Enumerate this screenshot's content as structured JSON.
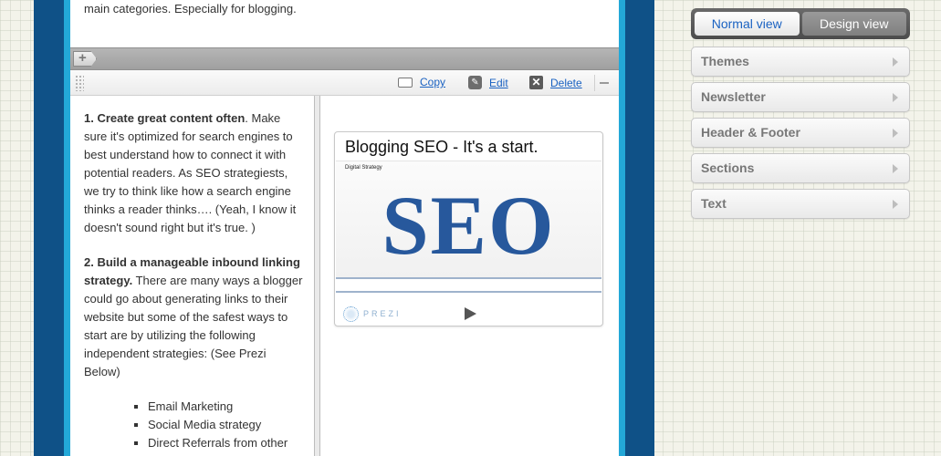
{
  "intro": {
    "text": "main categories. Especially for blogging."
  },
  "add_bar": {
    "add_glyph": "+"
  },
  "toolbar": {
    "copy_label": "Copy",
    "edit_label": "Edit",
    "delete_label": "Delete"
  },
  "content": {
    "para1_bold": "1. Create great content often",
    "para1_rest": ". Make sure it's optimized for search engines to best understand how to connect it with potential readers. As SEO strategiests, we try to think like how a search engine thinks a reader thinks…. (Yeah, I know it doesn't sound right but it's true. )",
    "para2_bold": "2. Build a manageable inbound linking strategy.",
    "para2_rest": " There are many ways a blogger could go about generating links to their website but some of the safest ways to start are by utilizing the following independent strategies: (See Prezi Below)",
    "list": [
      "Email Marketing",
      "Social Media strategy",
      "Direct Referrals from other"
    ]
  },
  "prezi": {
    "title": "Blogging SEO - It's a start.",
    "caption": "Digital Strategy",
    "slide_text": "SEO",
    "logo_text": "PREZI"
  },
  "sidebar": {
    "normal_view": "Normal view",
    "design_view": "Design view",
    "panels": [
      "Themes",
      "Newsletter",
      "Header & Footer",
      "Sections",
      "Text"
    ]
  },
  "colors": {
    "frame_dark_blue": "#0f5187",
    "frame_light_blue": "#23a8d8",
    "link_blue": "#1a62c2",
    "seo_blue": "#27589c"
  }
}
